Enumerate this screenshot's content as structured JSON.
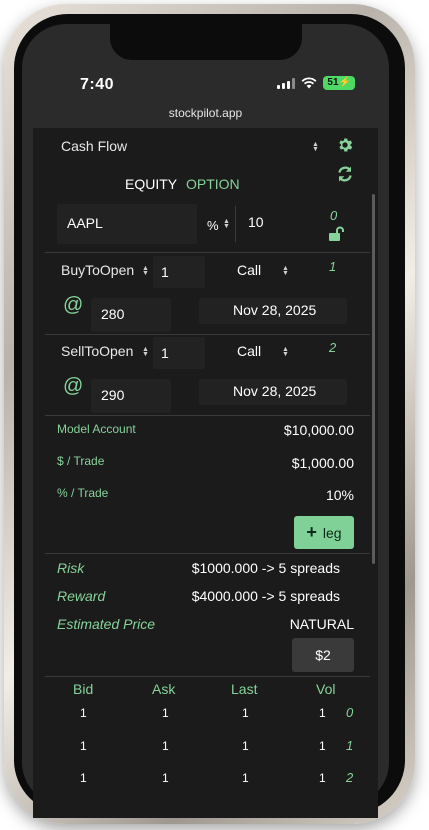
{
  "status_bar": {
    "time": "7:40",
    "battery": "51",
    "icons": [
      "cellular-signal-icon",
      "wifi-icon",
      "battery-charging-icon"
    ]
  },
  "browser": {
    "url": "stockpilot.app"
  },
  "header": {
    "strategy_select": "Cash Flow",
    "tab_equity": "EQUITY",
    "tab_option": "OPTION",
    "icons": [
      "gear-icon",
      "refresh-icon"
    ]
  },
  "symbol_row": {
    "symbol": "AAPL",
    "unit": "%",
    "amount": "10",
    "index": "0",
    "lock_icon": "unlock-icon"
  },
  "legs": [
    {
      "action": "BuyToOpen",
      "quantity": "1",
      "type": "Call",
      "index": "1",
      "at": "@",
      "strike": "280",
      "expiry": "Nov 28, 2025"
    },
    {
      "action": "SellToOpen",
      "quantity": "1",
      "type": "Call",
      "index": "2",
      "at": "@",
      "strike": "290",
      "expiry": "Nov 28, 2025"
    }
  ],
  "account": {
    "model_label": "Model Account",
    "model_value": "$10,000.00",
    "per_trade_label": "$ / Trade",
    "per_trade_value": "$1,000.00",
    "pct_trade_label": "% / Trade",
    "pct_trade_value": "10%"
  },
  "leg_button": {
    "label": "leg"
  },
  "summary": {
    "risk_label": "Risk",
    "risk_value": "$1000.000 -> 5 spreads",
    "reward_label": "Reward",
    "reward_value": "$4000.000 -> 5 spreads",
    "estimated_label": "Estimated Price",
    "estimated_mode": "NATURAL",
    "estimated_value": "$2"
  },
  "quote_table": {
    "headers": [
      "Bid",
      "Ask",
      "Last",
      "Vol"
    ],
    "rows": [
      {
        "bid": "1",
        "ask": "1",
        "last": "1",
        "vol": "1",
        "idx": "0"
      },
      {
        "bid": "1",
        "ask": "1",
        "last": "1",
        "vol": "1",
        "idx": "1"
      },
      {
        "bid": "1",
        "ask": "1",
        "last": "1",
        "vol": "1",
        "idx": "2"
      }
    ]
  },
  "colors": {
    "accent_green": "#86d29a",
    "button_green": "#7fd197",
    "app_background": "#1b1b1b",
    "battery_green": "#4cd964"
  }
}
